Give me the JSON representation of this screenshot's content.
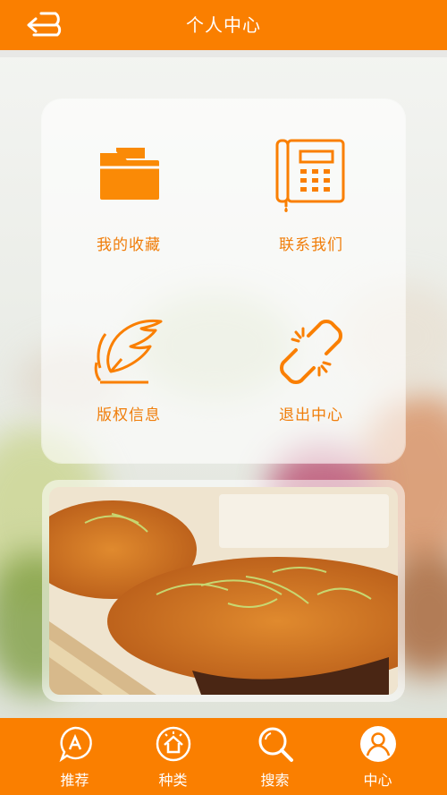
{
  "header": {
    "title": "个人中心",
    "back_icon": "back-arrow-icon"
  },
  "menu": {
    "items": [
      {
        "label": "我的收藏",
        "icon": "folder-icon"
      },
      {
        "label": "联系我们",
        "icon": "telephone-icon"
      },
      {
        "label": "版权信息",
        "icon": "feather-quill-icon"
      },
      {
        "label": "退出中心",
        "icon": "broken-link-icon"
      }
    ]
  },
  "banner": {
    "image": "meat-floss-bread-photo"
  },
  "tabs": [
    {
      "label": "推荐",
      "icon": "recommend-icon"
    },
    {
      "label": "种类",
      "icon": "category-icon"
    },
    {
      "label": "搜索",
      "icon": "search-icon"
    },
    {
      "label": "中心",
      "icon": "user-icon",
      "active": true
    }
  ],
  "colors": {
    "accent": "#fa7f00",
    "label": "#f07d09",
    "white": "#ffffff"
  }
}
